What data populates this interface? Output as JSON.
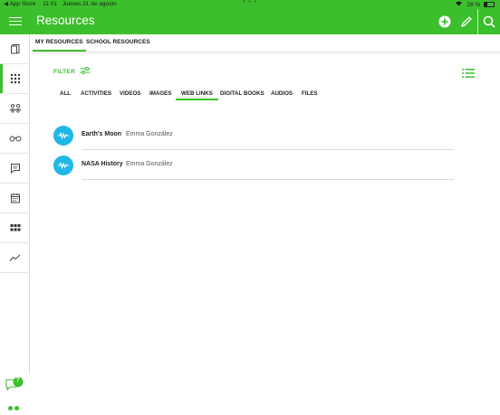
{
  "status": {
    "back_app": "◀ App Store",
    "time": "11:01",
    "date": "Jueves 31 de agosto",
    "battery": "28 %",
    "battery_level": 0.28,
    "center_dots": "• • •"
  },
  "header": {
    "title": "Resources"
  },
  "subnav": {
    "tabs": [
      {
        "label": "MY RESOURCES",
        "active": true
      },
      {
        "label": "SCHOOL RESOURCES",
        "active": false
      }
    ]
  },
  "filter": {
    "label": "FILTER"
  },
  "types": [
    {
      "label": "ALL",
      "active": false
    },
    {
      "label": "ACTIVITIES",
      "active": false
    },
    {
      "label": "VIDEOS",
      "active": false
    },
    {
      "label": "IMAGES",
      "active": false
    },
    {
      "label": "WEB LINKS",
      "active": true
    },
    {
      "label": "DIGITAL BOOKS",
      "active": false
    },
    {
      "label": "AUDIOS",
      "active": false
    },
    {
      "label": "FILES",
      "active": false
    }
  ],
  "resources": [
    {
      "name": "Earth's Moon",
      "owner": "Emma González"
    },
    {
      "name": "NASA History",
      "owner": "Emma González"
    }
  ],
  "help": {
    "badge": "?"
  },
  "colors": {
    "brand": "#3cbf2c",
    "link_icon": "#1fb8e6"
  },
  "sidebar": {
    "items": [
      "book-icon",
      "apps-grid-icon",
      "groups-icon",
      "glasses-icon",
      "chat-icon",
      "calendar-icon",
      "dashboard-icon",
      "trend-icon"
    ]
  }
}
